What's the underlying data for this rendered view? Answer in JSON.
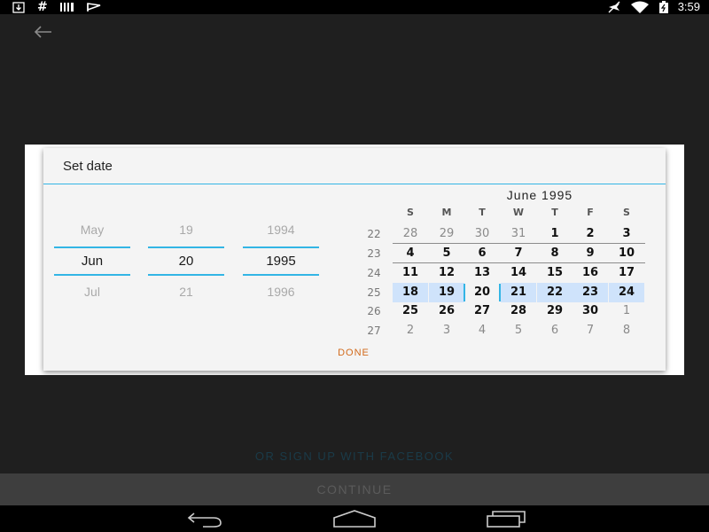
{
  "status_bar": {
    "left_icons": [
      "download-icon",
      "hash-icon",
      "barcode-icon",
      "flag-icon"
    ],
    "right_icons": [
      "airplane-off-icon",
      "wifi-icon",
      "battery-icon"
    ],
    "time": "3:59"
  },
  "dialog": {
    "title": "Set date",
    "spinners": {
      "month": {
        "prev": "May",
        "current": "Jun",
        "next": "Jul"
      },
      "day": {
        "prev": "19",
        "current": "20",
        "next": "21"
      },
      "year": {
        "prev": "1994",
        "current": "1995",
        "next": "1996"
      }
    },
    "calendar": {
      "month_label": "June 1995",
      "days_of_week": [
        "S",
        "M",
        "T",
        "W",
        "T",
        "F",
        "S"
      ],
      "weeks": [
        {
          "number": "22",
          "days": [
            "28",
            "29",
            "30",
            "31",
            "1",
            "2",
            "3"
          ]
        },
        {
          "number": "23",
          "days": [
            "4",
            "5",
            "6",
            "7",
            "8",
            "9",
            "10"
          ]
        },
        {
          "number": "24",
          "days": [
            "11",
            "12",
            "13",
            "14",
            "15",
            "16",
            "17"
          ]
        },
        {
          "number": "25",
          "days": [
            "18",
            "19",
            "20",
            "21",
            "22",
            "23",
            "24"
          ]
        },
        {
          "number": "26",
          "days": [
            "25",
            "26",
            "27",
            "28",
            "29",
            "30",
            "1"
          ]
        },
        {
          "number": "27",
          "days": [
            "2",
            "3",
            "4",
            "5",
            "6",
            "7",
            "8"
          ]
        }
      ],
      "selected_day": "20",
      "accent_color": "#33b5e5",
      "selected_week_color": "#cfe3fb"
    },
    "done_label": "DONE",
    "done_color": "#d26a1c"
  },
  "screen": {
    "facebook_link": "OR SIGN UP WITH FACEBOOK",
    "continue_label": "CONTINUE"
  },
  "nav_bar": {
    "icons": [
      "back-icon",
      "home-icon",
      "recents-icon"
    ]
  }
}
